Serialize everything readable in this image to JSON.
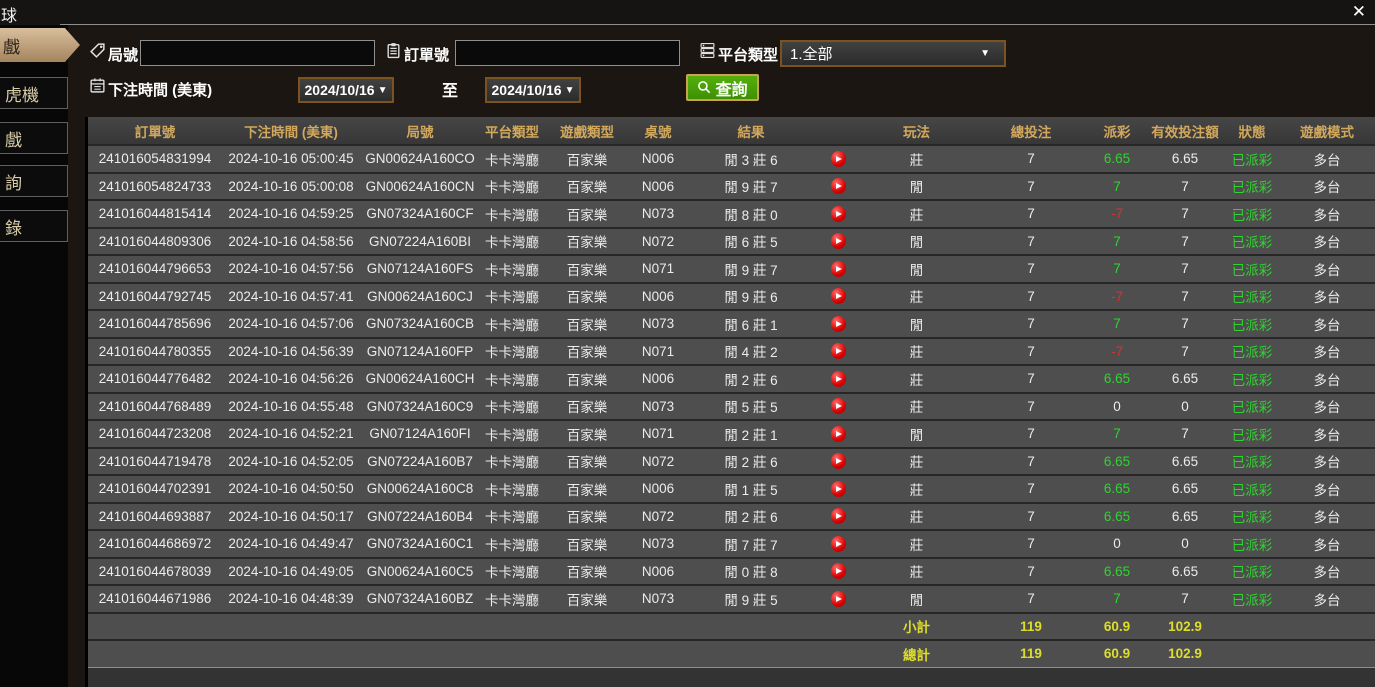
{
  "window": {
    "title": "球",
    "close_glyph": "✕"
  },
  "sidebar": {
    "items": [
      {
        "label": "戲",
        "active": true
      },
      {
        "label": "虎機",
        "active": false
      },
      {
        "label": "戲",
        "active": false
      },
      {
        "label": "詢",
        "active": false
      },
      {
        "label": "錄",
        "active": false
      }
    ]
  },
  "filters": {
    "round_no": {
      "label": "局號",
      "value": "",
      "icon": "tag-icon"
    },
    "order_no": {
      "label": "訂單號",
      "value": "",
      "icon": "clipboard-icon"
    },
    "platform": {
      "label": "平台類型",
      "value": "1.全部",
      "caret": "▼",
      "icon": "list-icon"
    },
    "bet_time": {
      "label": "下注時間 (美東)",
      "from": "2024/10/16",
      "to_label": "至",
      "to": "2024/10/16",
      "caret": "▼",
      "icon": "calendar-icon"
    },
    "search": {
      "label": "查詢",
      "icon": "search-icon"
    }
  },
  "table": {
    "headers": [
      "訂單號",
      "下注時間 (美東)",
      "局號",
      "平台類型",
      "遊戲類型",
      "桌號",
      "結果",
      "",
      "玩法",
      "總投注",
      "派彩",
      "有效投注額",
      "狀態",
      "遊戲模式"
    ],
    "rows": [
      {
        "order_id": "241016054831994",
        "bet_time": "2024-10-16 05:00:45",
        "round_id": "GN00624A160CO",
        "platform": "卡卡灣廳",
        "game_type": "百家樂",
        "table_no": "N006",
        "result": "閒 3 莊 6",
        "play_method": "莊",
        "total_bet": "7",
        "payout": "6.65",
        "payout_color": "green",
        "valid_bet": "6.65",
        "status": "已派彩",
        "game_mode": "多台"
      },
      {
        "order_id": "241016054824733",
        "bet_time": "2024-10-16 05:00:08",
        "round_id": "GN00624A160CN",
        "platform": "卡卡灣廳",
        "game_type": "百家樂",
        "table_no": "N006",
        "result": "閒 9 莊 7",
        "play_method": "閒",
        "total_bet": "7",
        "payout": "7",
        "payout_color": "green",
        "valid_bet": "7",
        "status": "已派彩",
        "game_mode": "多台"
      },
      {
        "order_id": "241016044815414",
        "bet_time": "2024-10-16 04:59:25",
        "round_id": "GN07324A160CF",
        "platform": "卡卡灣廳",
        "game_type": "百家樂",
        "table_no": "N073",
        "result": "閒 8 莊 0",
        "play_method": "莊",
        "total_bet": "7",
        "payout": "-7",
        "payout_color": "red",
        "valid_bet": "7",
        "status": "已派彩",
        "game_mode": "多台"
      },
      {
        "order_id": "241016044809306",
        "bet_time": "2024-10-16 04:58:56",
        "round_id": "GN07224A160BI",
        "platform": "卡卡灣廳",
        "game_type": "百家樂",
        "table_no": "N072",
        "result": "閒 6 莊 5",
        "play_method": "閒",
        "total_bet": "7",
        "payout": "7",
        "payout_color": "green",
        "valid_bet": "7",
        "status": "已派彩",
        "game_mode": "多台"
      },
      {
        "order_id": "241016044796653",
        "bet_time": "2024-10-16 04:57:56",
        "round_id": "GN07124A160FS",
        "platform": "卡卡灣廳",
        "game_type": "百家樂",
        "table_no": "N071",
        "result": "閒 9 莊 7",
        "play_method": "閒",
        "total_bet": "7",
        "payout": "7",
        "payout_color": "green",
        "valid_bet": "7",
        "status": "已派彩",
        "game_mode": "多台"
      },
      {
        "order_id": "241016044792745",
        "bet_time": "2024-10-16 04:57:41",
        "round_id": "GN00624A160CJ",
        "platform": "卡卡灣廳",
        "game_type": "百家樂",
        "table_no": "N006",
        "result": "閒 9 莊 6",
        "play_method": "莊",
        "total_bet": "7",
        "payout": "-7",
        "payout_color": "red",
        "valid_bet": "7",
        "status": "已派彩",
        "game_mode": "多台"
      },
      {
        "order_id": "241016044785696",
        "bet_time": "2024-10-16 04:57:06",
        "round_id": "GN07324A160CB",
        "platform": "卡卡灣廳",
        "game_type": "百家樂",
        "table_no": "N073",
        "result": "閒 6 莊 1",
        "play_method": "閒",
        "total_bet": "7",
        "payout": "7",
        "payout_color": "green",
        "valid_bet": "7",
        "status": "已派彩",
        "game_mode": "多台"
      },
      {
        "order_id": "241016044780355",
        "bet_time": "2024-10-16 04:56:39",
        "round_id": "GN07124A160FP",
        "platform": "卡卡灣廳",
        "game_type": "百家樂",
        "table_no": "N071",
        "result": "閒 4 莊 2",
        "play_method": "莊",
        "total_bet": "7",
        "payout": "-7",
        "payout_color": "red",
        "valid_bet": "7",
        "status": "已派彩",
        "game_mode": "多台"
      },
      {
        "order_id": "241016044776482",
        "bet_time": "2024-10-16 04:56:26",
        "round_id": "GN00624A160CH",
        "platform": "卡卡灣廳",
        "game_type": "百家樂",
        "table_no": "N006",
        "result": "閒 2 莊 6",
        "play_method": "莊",
        "total_bet": "7",
        "payout": "6.65",
        "payout_color": "green",
        "valid_bet": "6.65",
        "status": "已派彩",
        "game_mode": "多台"
      },
      {
        "order_id": "241016044768489",
        "bet_time": "2024-10-16 04:55:48",
        "round_id": "GN07324A160C9",
        "platform": "卡卡灣廳",
        "game_type": "百家樂",
        "table_no": "N073",
        "result": "閒 5 莊 5",
        "play_method": "莊",
        "total_bet": "7",
        "payout": "0",
        "payout_color": "white",
        "valid_bet": "0",
        "status": "已派彩",
        "game_mode": "多台"
      },
      {
        "order_id": "241016044723208",
        "bet_time": "2024-10-16 04:52:21",
        "round_id": "GN07124A160FI",
        "platform": "卡卡灣廳",
        "game_type": "百家樂",
        "table_no": "N071",
        "result": "閒 2 莊 1",
        "play_method": "閒",
        "total_bet": "7",
        "payout": "7",
        "payout_color": "green",
        "valid_bet": "7",
        "status": "已派彩",
        "game_mode": "多台"
      },
      {
        "order_id": "241016044719478",
        "bet_time": "2024-10-16 04:52:05",
        "round_id": "GN07224A160B7",
        "platform": "卡卡灣廳",
        "game_type": "百家樂",
        "table_no": "N072",
        "result": "閒 2 莊 6",
        "play_method": "莊",
        "total_bet": "7",
        "payout": "6.65",
        "payout_color": "green",
        "valid_bet": "6.65",
        "status": "已派彩",
        "game_mode": "多台"
      },
      {
        "order_id": "241016044702391",
        "bet_time": "2024-10-16 04:50:50",
        "round_id": "GN00624A160C8",
        "platform": "卡卡灣廳",
        "game_type": "百家樂",
        "table_no": "N006",
        "result": "閒 1 莊 5",
        "play_method": "莊",
        "total_bet": "7",
        "payout": "6.65",
        "payout_color": "green",
        "valid_bet": "6.65",
        "status": "已派彩",
        "game_mode": "多台"
      },
      {
        "order_id": "241016044693887",
        "bet_time": "2024-10-16 04:50:17",
        "round_id": "GN07224A160B4",
        "platform": "卡卡灣廳",
        "game_type": "百家樂",
        "table_no": "N072",
        "result": "閒 2 莊 6",
        "play_method": "莊",
        "total_bet": "7",
        "payout": "6.65",
        "payout_color": "green",
        "valid_bet": "6.65",
        "status": "已派彩",
        "game_mode": "多台"
      },
      {
        "order_id": "241016044686972",
        "bet_time": "2024-10-16 04:49:47",
        "round_id": "GN07324A160C1",
        "platform": "卡卡灣廳",
        "game_type": "百家樂",
        "table_no": "N073",
        "result": "閒 7 莊 7",
        "play_method": "莊",
        "total_bet": "7",
        "payout": "0",
        "payout_color": "white",
        "valid_bet": "0",
        "status": "已派彩",
        "game_mode": "多台"
      },
      {
        "order_id": "241016044678039",
        "bet_time": "2024-10-16 04:49:05",
        "round_id": "GN00624A160C5",
        "platform": "卡卡灣廳",
        "game_type": "百家樂",
        "table_no": "N006",
        "result": "閒 0 莊 8",
        "play_method": "莊",
        "total_bet": "7",
        "payout": "6.65",
        "payout_color": "green",
        "valid_bet": "6.65",
        "status": "已派彩",
        "game_mode": "多台"
      },
      {
        "order_id": "241016044671986",
        "bet_time": "2024-10-16 04:48:39",
        "round_id": "GN07324A160BZ",
        "platform": "卡卡灣廳",
        "game_type": "百家樂",
        "table_no": "N073",
        "result": "閒 9 莊 5",
        "play_method": "閒",
        "total_bet": "7",
        "payout": "7",
        "payout_color": "green",
        "valid_bet": "7",
        "status": "已派彩",
        "game_mode": "多台"
      }
    ],
    "subtotal": {
      "label": "小計",
      "total_bet": "119",
      "payout": "60.9",
      "valid_bet": "102.9"
    },
    "grand_total": {
      "label": "總計",
      "total_bet": "119",
      "payout": "60.9",
      "valid_bet": "102.9"
    }
  },
  "colors": {
    "header_gold": "#d2a85c",
    "positive_green": "#2fd42f",
    "negative_red": "#cf3535",
    "total_yellow": "#dede2a",
    "status_green": "#2fd42f",
    "search_button_green": "#49a206",
    "active_tab_tan": "#c9ab84"
  }
}
